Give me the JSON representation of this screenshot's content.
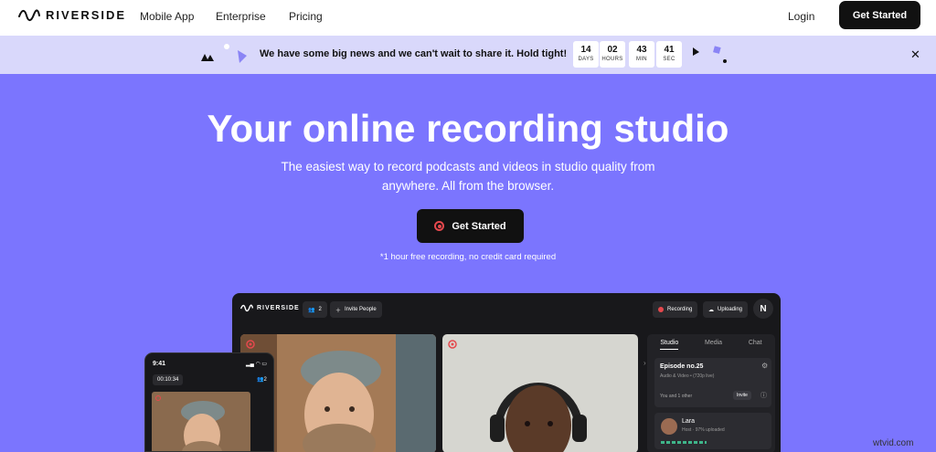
{
  "nav": {
    "logo_text": "RIVERSIDE",
    "links": [
      "Mobile App",
      "Enterprise",
      "Pricing"
    ],
    "login": "Login",
    "cta": "Get Started"
  },
  "banner": {
    "text": "We have some big news and we can't wait to share it. Hold tight!",
    "countdown": [
      {
        "value": "14",
        "unit": "DAYS"
      },
      {
        "value": "02",
        "unit": "HOURS"
      },
      {
        "value": "43",
        "unit": "MIN"
      },
      {
        "value": "41",
        "unit": "SEC"
      }
    ],
    "close_icon": "close-icon"
  },
  "hero": {
    "title": "Your online recording studio",
    "subtitle": "The easiest way to record podcasts and videos in studio quality from anywhere. All from the browser.",
    "cta": "Get Started",
    "note": "*1 hour free recording, no credit card required"
  },
  "studio": {
    "logo_text": "RIVERSIDE",
    "participants": "2",
    "invite": "Invite People",
    "recording": "Recording",
    "uploading": "Uploading",
    "avatar": "N",
    "tabs": [
      "Studio",
      "Media",
      "Chat"
    ],
    "episode_title": "Episode no.25",
    "episode_sub": "Audio & Video • (720p live)",
    "you_and": "You and 1 other",
    "invite_small": "Invite",
    "guest_name": "Lara",
    "guest_sub": "Host · 97% uploaded"
  },
  "phone": {
    "time": "9:41",
    "timer": "00:10:34",
    "participants": "2"
  },
  "watermark": "wtvid.com",
  "colors": {
    "hero_bg": "#7b75fe",
    "banner_bg": "#d9d8fb",
    "dark": "#111111",
    "record_red": "#e5484d"
  }
}
